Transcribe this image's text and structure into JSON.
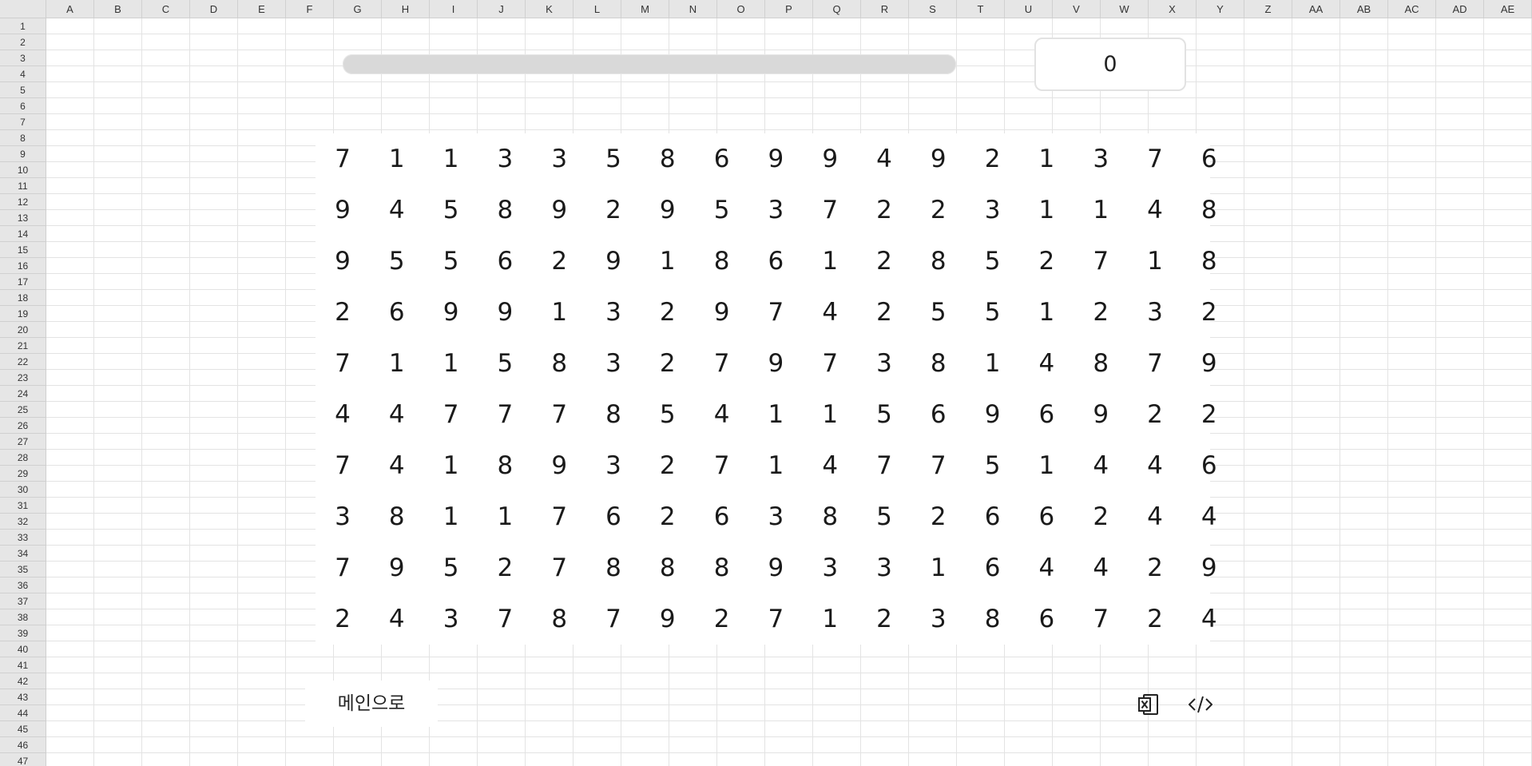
{
  "spreadsheet": {
    "columns": [
      "A",
      "B",
      "C",
      "D",
      "E",
      "F",
      "G",
      "H",
      "I",
      "J",
      "K",
      "L",
      "M",
      "N",
      "O",
      "P",
      "Q",
      "R",
      "S",
      "T",
      "U",
      "V",
      "W",
      "X",
      "Y",
      "Z",
      "AA",
      "AB",
      "AC",
      "AD",
      "AE"
    ],
    "rows": [
      "1",
      "2",
      "3",
      "4",
      "5",
      "6",
      "7",
      "8",
      "9",
      "10",
      "11",
      "12",
      "13",
      "14",
      "15",
      "16",
      "17",
      "18",
      "19",
      "20",
      "21",
      "22",
      "23",
      "24",
      "25",
      "26",
      "27",
      "28",
      "29",
      "30",
      "31",
      "32",
      "33",
      "34",
      "35",
      "36",
      "37",
      "38",
      "39",
      "40",
      "41",
      "42",
      "43",
      "44",
      "45",
      "46",
      "47"
    ]
  },
  "game": {
    "progress": 0,
    "score": "0",
    "board": [
      [
        "7",
        "1",
        "1",
        "3",
        "3",
        "5",
        "8",
        "6",
        "9",
        "9",
        "4",
        "9",
        "2",
        "1",
        "3",
        "7",
        "6"
      ],
      [
        "9",
        "4",
        "5",
        "8",
        "9",
        "2",
        "9",
        "5",
        "3",
        "7",
        "2",
        "2",
        "3",
        "1",
        "1",
        "4",
        "8"
      ],
      [
        "9",
        "5",
        "5",
        "6",
        "2",
        "9",
        "1",
        "8",
        "6",
        "1",
        "2",
        "8",
        "5",
        "2",
        "7",
        "1",
        "8"
      ],
      [
        "2",
        "6",
        "9",
        "9",
        "1",
        "3",
        "2",
        "9",
        "7",
        "4",
        "2",
        "5",
        "5",
        "1",
        "2",
        "3",
        "2"
      ],
      [
        "7",
        "1",
        "1",
        "5",
        "8",
        "3",
        "2",
        "7",
        "9",
        "7",
        "3",
        "8",
        "1",
        "4",
        "8",
        "7",
        "9"
      ],
      [
        "4",
        "4",
        "7",
        "7",
        "7",
        "8",
        "5",
        "4",
        "1",
        "1",
        "5",
        "6",
        "9",
        "6",
        "9",
        "2",
        "2"
      ],
      [
        "7",
        "4",
        "1",
        "8",
        "9",
        "3",
        "2",
        "7",
        "1",
        "4",
        "7",
        "7",
        "5",
        "1",
        "4",
        "4",
        "6"
      ],
      [
        "3",
        "8",
        "1",
        "1",
        "7",
        "6",
        "2",
        "6",
        "3",
        "8",
        "5",
        "2",
        "6",
        "6",
        "2",
        "4",
        "4"
      ],
      [
        "7",
        "9",
        "5",
        "2",
        "7",
        "8",
        "8",
        "8",
        "9",
        "3",
        "3",
        "1",
        "6",
        "4",
        "4",
        "2",
        "9"
      ],
      [
        "2",
        "4",
        "3",
        "7",
        "8",
        "7",
        "9",
        "2",
        "7",
        "1",
        "2",
        "3",
        "8",
        "6",
        "7",
        "2",
        "4"
      ]
    ],
    "main_button_label": "메인으로",
    "icons": {
      "excel": "excel-icon",
      "code": "code-icon"
    }
  }
}
